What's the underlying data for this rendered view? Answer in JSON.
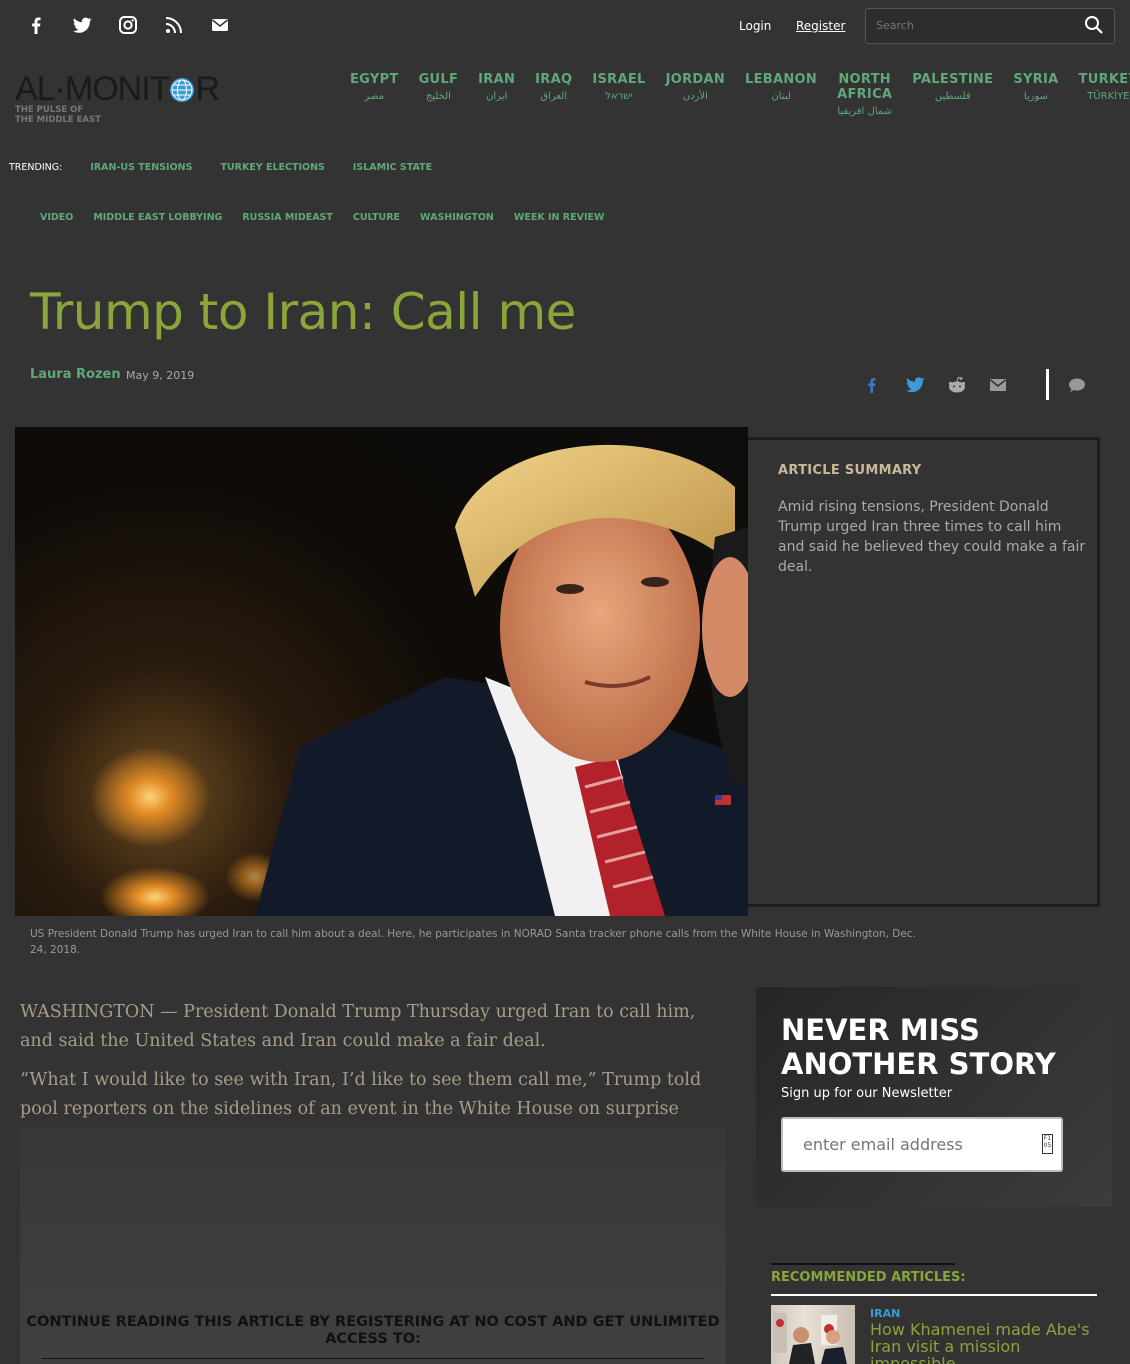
{
  "topbar": {
    "social": [
      "facebook-icon",
      "twitter-icon",
      "instagram-icon",
      "rss-icon",
      "email-icon"
    ],
    "login": "Login",
    "register": "Register",
    "search_placeholder": "Search"
  },
  "logo": {
    "left": "AL·MONIT",
    "right": "R",
    "tagline_1": "THE PULSE OF",
    "tagline_2": "THE MIDDLE EAST"
  },
  "regions": [
    {
      "en": "EGYPT",
      "ar": "مصر"
    },
    {
      "en": "GULF",
      "ar": "الخليج"
    },
    {
      "en": "IRAN",
      "ar": "ایران"
    },
    {
      "en": "IRAQ",
      "ar": "العراق"
    },
    {
      "en": "ISRAEL",
      "ar": "ישראל"
    },
    {
      "en": "JORDAN",
      "ar": "الأردن"
    },
    {
      "en": "LEBANON",
      "ar": "لبنان"
    },
    {
      "en": "NORTH AFRICA",
      "ar": "شمال افريقيا"
    },
    {
      "en": "PALESTINE",
      "ar": "فلسطين"
    },
    {
      "en": "SYRIA",
      "ar": "سوريا"
    },
    {
      "en": "TURKEY",
      "ar": "TÜRKİYE"
    }
  ],
  "trending": {
    "label": "TRENDING:",
    "items": [
      "IRAN-US TENSIONS",
      "TURKEY ELECTIONS",
      "ISLAMIC STATE"
    ]
  },
  "subnav": [
    "VIDEO",
    "MIDDLE EAST LOBBYING",
    "RUSSIA MIDEAST",
    "CULTURE",
    "WASHINGTON",
    "WEEK IN REVIEW"
  ],
  "article": {
    "title": "Trump to Iran: Call me",
    "author": "Laura Rozen",
    "date": "May 9, 2019",
    "summary_title": "ARTICLE SUMMARY",
    "summary": "Amid rising tensions, President Donald Trump urged Iran three times to call him and said he believed they could make a fair deal.",
    "caption": "US President Donald Trump has urged Iran to call him about a deal. Here, he participates in NORAD Santa tracker phone calls from the White House in Washington, Dec. 24, 2018.",
    "paragraphs": [
      "WASHINGTON — President Donald Trump Thursday urged Iran to call him, and said the United States and Iran could make a fair deal.",
      "“What I would like to see with Iran, I’d like to see them call me,” Trump told pool reporters on the sidelines of an event in the White House on surprise medical"
    ],
    "paywall_msg": "CONTINUE READING THIS ARTICLE BY REGISTERING AT NO COST AND GET UNLIMITED ACCESS TO:"
  },
  "newsletter": {
    "title_1": "NEVER MISS",
    "title_2": "ANOTHER STORY",
    "subtitle": "Sign up for our Newsletter",
    "placeholder": "enter email address",
    "button_glyph": "F1\n05"
  },
  "recommended": {
    "title": "RECOMMENDED ARTICLES:",
    "items": [
      {
        "category": "IRAN",
        "headline": "How Khamenei made Abe's Iran visit a mission impossible"
      }
    ]
  },
  "colors": {
    "background": "#333333",
    "accent_green": "#8aa53a",
    "nav_green": "#5fa87a",
    "link_blue": "#3b9bd6"
  }
}
